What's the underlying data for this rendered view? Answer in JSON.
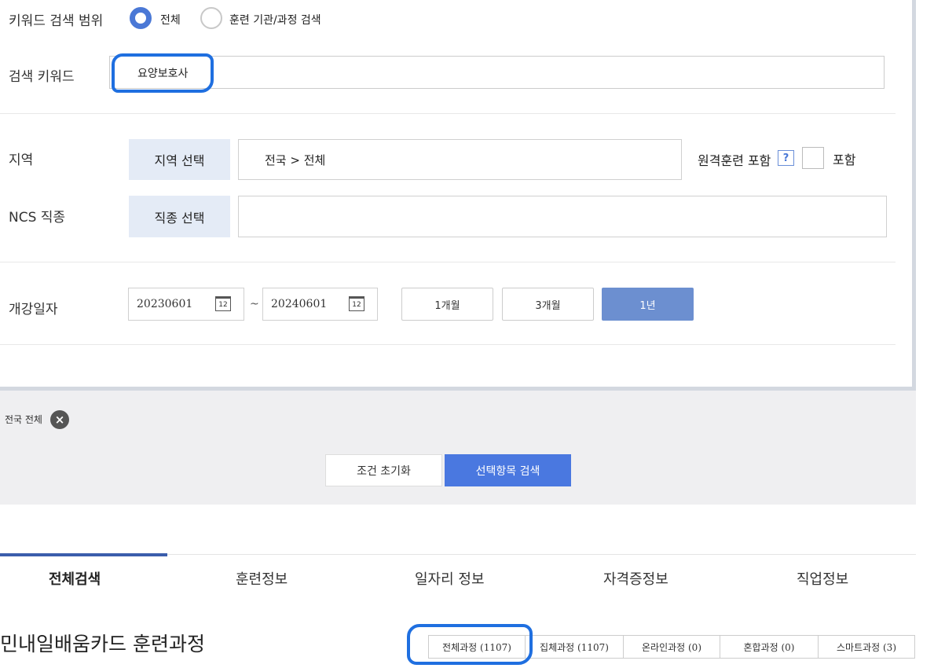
{
  "keyword_scope": {
    "label": "키워드 검색 범위",
    "options": [
      {
        "label": "전체",
        "selected": true
      },
      {
        "label": "훈련 기관/과정 검색",
        "selected": false
      }
    ]
  },
  "keyword": {
    "label": "검색 키워드",
    "value": "요양보호사"
  },
  "region": {
    "label": "지역",
    "button": "지역 선택",
    "value": "전국 > 전체",
    "remote_label": "원격훈련 포함",
    "help_icon": "?",
    "include_label": "포함"
  },
  "ncs": {
    "label": "NCS 직종",
    "button": "직종 선택",
    "value": ""
  },
  "dates": {
    "label": "개강일자",
    "start": "20230601",
    "end": "20240601",
    "separator": "~",
    "cal_day": "12",
    "periods": [
      {
        "label": "1개월",
        "active": false
      },
      {
        "label": "3개월",
        "active": false
      },
      {
        "label": "1년",
        "active": true
      }
    ]
  },
  "chips": [
    {
      "label": "전국 전체",
      "remove_icon": "×"
    }
  ],
  "actions": {
    "reset": "조건 초기화",
    "search": "선택항목 검색"
  },
  "tabs": [
    {
      "label": "전체검색",
      "active": true
    },
    {
      "label": "훈련정보",
      "active": false
    },
    {
      "label": "일자리 정보",
      "active": false
    },
    {
      "label": "자격증정보",
      "active": false
    },
    {
      "label": "직업정보",
      "active": false
    }
  ],
  "section": {
    "title": "민내일배움카드 훈련과정",
    "filters": [
      "전체과정 (1107)",
      "집체과정 (1107)",
      "온라인과정 (0)",
      "혼합과정 (0)",
      "스마트과정 (3)"
    ]
  },
  "colors": {
    "accent": "#4a78e0",
    "highlight_annotation": "#1f6fe0",
    "select_button_bg": "#e4ebf6"
  }
}
